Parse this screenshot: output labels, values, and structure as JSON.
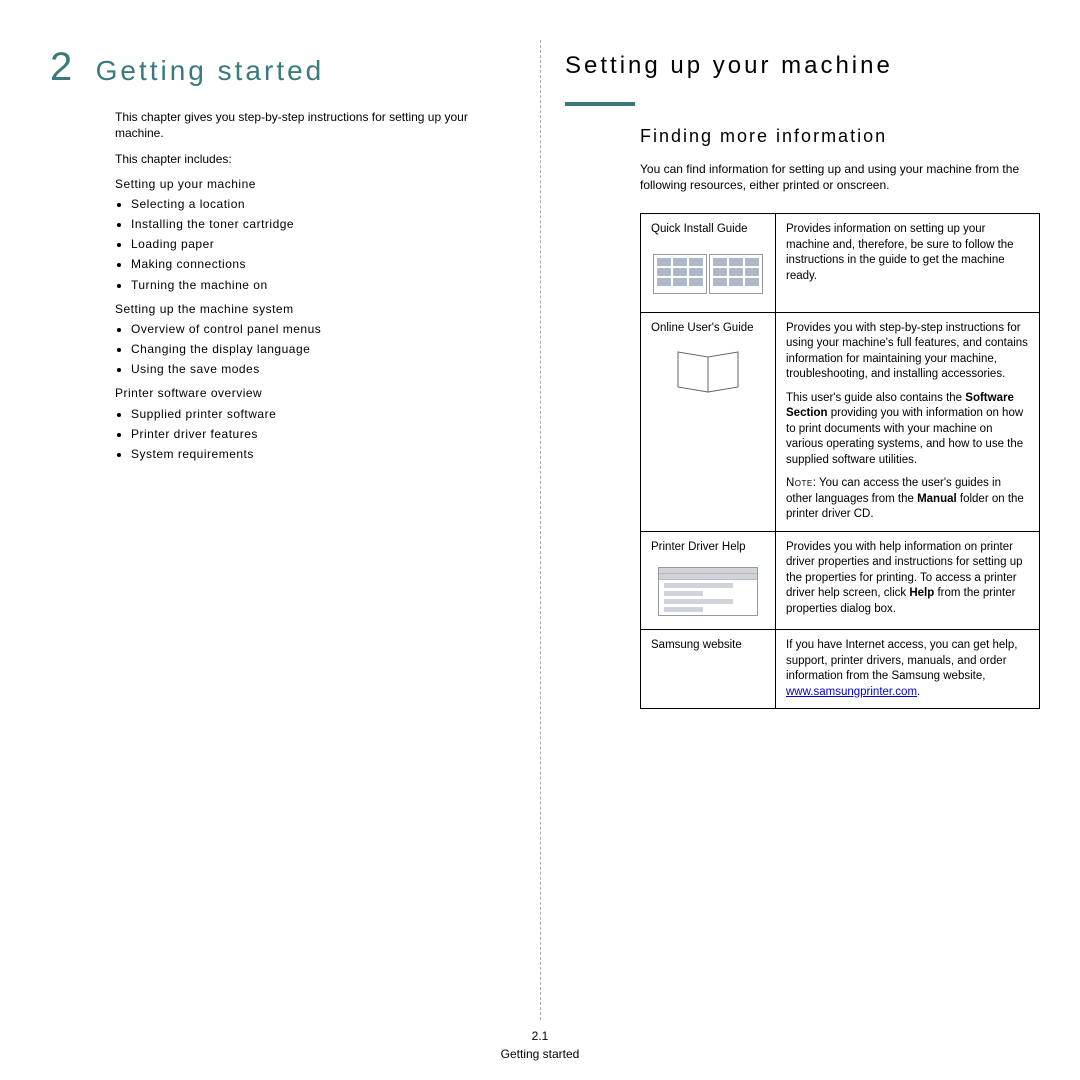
{
  "left": {
    "chapter_number": "2",
    "chapter_title": "Getting started",
    "intro": "This chapter gives you step-by-step instructions for setting up your machine.",
    "includes_label": "This chapter includes:",
    "sections": [
      {
        "heading": "Setting up your machine",
        "items": [
          "Selecting a location",
          "Installing the toner cartridge",
          "Loading paper",
          "Making connections",
          "Turning the machine on"
        ]
      },
      {
        "heading": "Setting up the machine system",
        "items": [
          "Overview of control panel menus",
          "Changing the display language",
          "Using the save modes"
        ]
      },
      {
        "heading": "Printer software overview",
        "items": [
          "Supplied printer software",
          "Printer driver features",
          "System requirements"
        ]
      }
    ]
  },
  "right": {
    "h1": "Setting up your machine",
    "h2": "Finding more information",
    "intro": "You can find information for setting up and using your machine from the following resources, either printed or onscreen.",
    "rows": [
      {
        "label": "Quick Install Guide",
        "desc_parts": [
          {
            "text": "Provides information on setting up your machine and, therefore, be sure to follow the instructions in the guide to get the machine ready."
          }
        ]
      },
      {
        "label": "Online User's Guide",
        "desc_parts": [
          {
            "text": "Provides you with step-by-step instructions for using your machine's full features, and contains information for maintaining your machine, troubleshooting, and installing accessories."
          },
          {
            "prefix": "This user's guide also contains the ",
            "bold": "Software Section",
            "suffix": " providing you with information on how to print documents with your machine on various operating systems, and how to use the supplied software utilities."
          },
          {
            "note_label": "Note",
            "note_text": ": You can access the user's guides in other languages from the ",
            "bold": "Manual",
            "suffix": " folder on the printer driver CD."
          }
        ]
      },
      {
        "label": "Printer Driver Help",
        "desc_parts": [
          {
            "prefix": "Provides you with help information on printer driver properties and instructions for setting up the properties for printing. To access a printer driver help screen, click ",
            "bold": "Help",
            "suffix": " from the printer properties dialog box."
          }
        ]
      },
      {
        "label": "Samsung website",
        "desc_parts": [
          {
            "prefix": "If you have Internet access, you can get help, support, printer drivers, manuals, and order information from the Samsung website, ",
            "link": "www.samsungprinter.com",
            "suffix": "."
          }
        ]
      }
    ]
  },
  "footer": {
    "page_number": "2.1",
    "page_label": "Getting started"
  }
}
